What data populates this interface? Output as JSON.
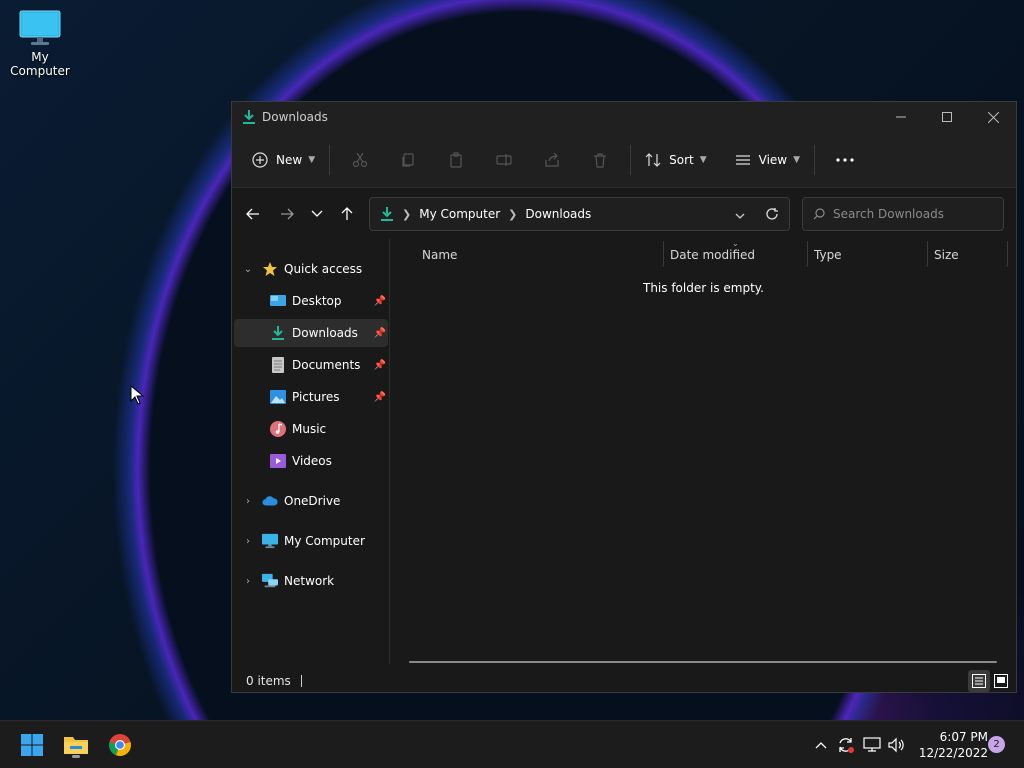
{
  "desktop": {
    "icons": [
      {
        "label": "My Computer",
        "icon": "monitor-icon"
      }
    ]
  },
  "window": {
    "title": "Downloads",
    "toolbar": {
      "new_label": "New",
      "sort_label": "Sort",
      "view_label": "View"
    },
    "address": {
      "crumbs": [
        "My Computer",
        "Downloads"
      ]
    },
    "search": {
      "placeholder": "Search Downloads"
    },
    "nav": {
      "quick_access": "Quick access",
      "items": [
        {
          "label": "Desktop",
          "pinned": true
        },
        {
          "label": "Downloads",
          "pinned": true,
          "selected": true
        },
        {
          "label": "Documents",
          "pinned": true
        },
        {
          "label": "Pictures",
          "pinned": true
        },
        {
          "label": "Music",
          "pinned": false
        },
        {
          "label": "Videos",
          "pinned": false
        }
      ],
      "roots": [
        "OneDrive",
        "My Computer",
        "Network"
      ]
    },
    "columns": [
      "Name",
      "Date modified",
      "Type",
      "Size"
    ],
    "empty_message": "This folder is empty.",
    "status": {
      "count": "0 items"
    }
  },
  "taskbar": {
    "time": "6:07 PM",
    "date": "12/22/2022",
    "notifications": "2"
  },
  "colors": {
    "accent": "#1fb89a",
    "folder": "#f3c340",
    "window_bg": "#191919",
    "titlebar_bg": "#202020"
  }
}
